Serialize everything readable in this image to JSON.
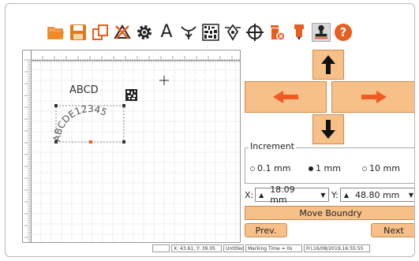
{
  "toolbar": {
    "tools": [
      {
        "name": "open-folder-icon",
        "color": "#f08a24"
      },
      {
        "name": "save-icon",
        "color": "#e07a1e"
      },
      {
        "name": "duplicate-icon",
        "color": "#e85d20"
      },
      {
        "name": "delete-shape-icon",
        "color": "#e85d20"
      },
      {
        "name": "settings-gear-icon",
        "color": "#222222"
      },
      {
        "name": "text-tool-icon",
        "label": "A"
      },
      {
        "name": "text-path-icon",
        "color": "#222222"
      },
      {
        "name": "datamatrix-icon",
        "color": "#222222"
      },
      {
        "name": "pen-tool-icon",
        "color": "#222222"
      },
      {
        "name": "crosshair-target-icon",
        "color": "#222222"
      },
      {
        "name": "trash-icon",
        "color": "#e85d20"
      },
      {
        "name": "marker-pen-icon",
        "color": "#e85d20"
      },
      {
        "name": "stamp-icon",
        "color": "#222222"
      },
      {
        "name": "help-icon",
        "color": "#e85d20",
        "label": "?"
      }
    ]
  },
  "canvas": {
    "text_straight": "ABCD",
    "text_arc": "ABCDE12345"
  },
  "navigation": {
    "up": "up-arrow-icon",
    "left": "left-arrow-icon",
    "right": "right-arrow-icon",
    "down": "down-arrow-icon"
  },
  "increment": {
    "title": "Increment",
    "options": [
      "0.1 mm",
      "1 mm",
      "10 mm"
    ],
    "selected": "1 mm"
  },
  "coords": {
    "x_label": "X:",
    "x_value": "18.09 mm",
    "y_label": "Y:",
    "y_value": "48.80 mm"
  },
  "buttons": {
    "move_boundary": "Move Boundry",
    "prev": "Prev.",
    "next": "Next"
  },
  "status": {
    "cursor": "X: 43.61, Y: 39.05",
    "file": "Untitled",
    "marking_time": "Marking Time = 0s",
    "datetime": "Fri,16/08/2019,16:55:55"
  },
  "colors": {
    "accent": "#f7c089",
    "accent_border": "#d08a4c",
    "icon_orange": "#e85d20"
  }
}
